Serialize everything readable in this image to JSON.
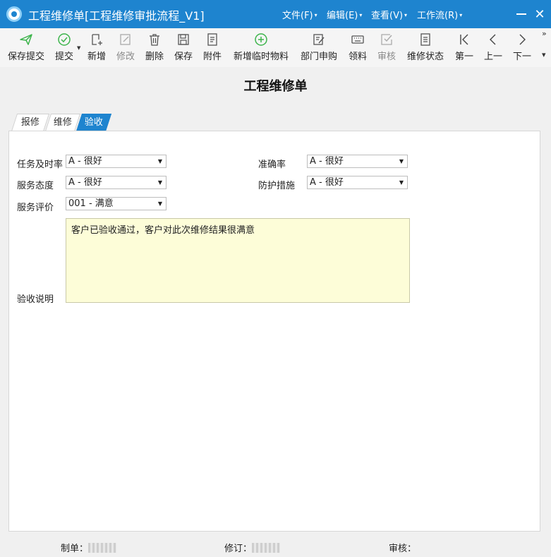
{
  "window": {
    "title": "工程维修单[工程维修审批流程_V1]",
    "menus": [
      "文件(F)",
      "编辑(E)",
      "查看(V)",
      "工作流(R)"
    ]
  },
  "toolbar": {
    "save_submit": "保存提交",
    "submit": "提交",
    "new": "新增",
    "modify": "修改",
    "delete": "删除",
    "save": "保存",
    "attachment": "附件",
    "new_temp_material": "新增临时物料",
    "dept_purchase": "部门申购",
    "pick_material": "领料",
    "review": "审核",
    "repair_status": "维修状态",
    "first": "第一",
    "prev": "上一",
    "next": "下一"
  },
  "form": {
    "title": "工程维修单",
    "tabs": [
      "报修",
      "维修",
      "验收"
    ],
    "active_tab": "验收",
    "fields": {
      "timeliness": {
        "label": "任务及时率",
        "value": "A - 很好"
      },
      "accuracy": {
        "label": "准确率",
        "value": "A - 很好"
      },
      "attitude": {
        "label": "服务态度",
        "value": "A - 很好"
      },
      "protection": {
        "label": "防护措施",
        "value": "A - 很好"
      },
      "evaluation": {
        "label": "服务评价",
        "value": "001 - 满意"
      },
      "acceptance_note": {
        "label": "验收说明",
        "value": "客户已验收通过，客户对此次维修结果很满意"
      }
    }
  },
  "footer": {
    "maker_label": "制单：",
    "revise_label": "修订：",
    "audit_label": "审核："
  },
  "colors": {
    "titlebar": "#1e84cf",
    "active_tab": "#1e84cf",
    "textarea_bg": "#fdfdd8",
    "add_icon": "#3cb44b"
  }
}
